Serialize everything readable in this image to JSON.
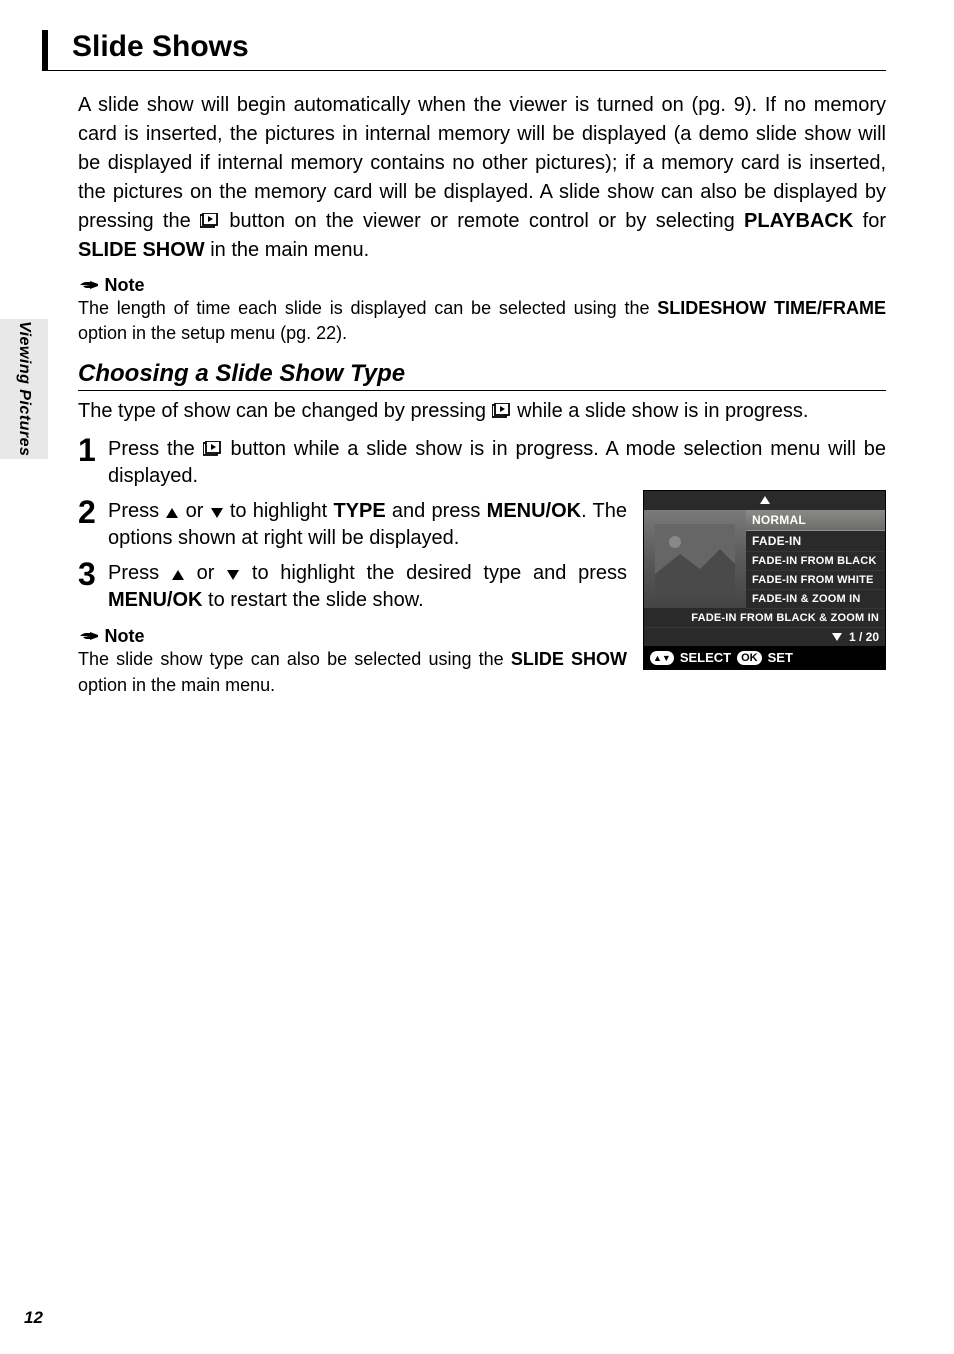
{
  "side_tab": "Viewing Pictures",
  "title": "Slide Shows",
  "intro": {
    "p1a": "A slide show will begin automatically when the viewer is turned on (pg. 9).  If no memory card is inserted, the pictures in internal memory will be displayed (a demo slide show will be displayed if internal memory contains no other pictures); if a memory card is inserted, the pictures on the memory card will be displayed.  A slide show can also be displayed by pressing the ",
    "p1b": " button on the viewer or remote control or by selecting ",
    "p1c": "PLAYBACK",
    "p1d": " for ",
    "p1e": "SLIDE SHOW",
    "p1f": " in the main menu."
  },
  "note1": {
    "label": "Note",
    "t1": "The length of time each slide is displayed can be selected using the ",
    "t2": "SLIDESHOW TIME/FRAME",
    "t3": " option in the setup menu (pg. 22)."
  },
  "sub": {
    "heading": "Choosing a Slide Show Type",
    "intro_a": "The type of show can be changed by pressing ",
    "intro_b": " while a slide show is in progress."
  },
  "steps": {
    "s1": {
      "n": "1",
      "a": "Press the ",
      "b": " button while a slide show is in progress.  A mode selection menu will be displayed."
    },
    "s2": {
      "n": "2",
      "a": "Press ",
      "b": " or ",
      "c": " to highlight ",
      "d": "TYPE",
      "e": " and press ",
      "f": "MENU/OK",
      "g": ".  The options shown at right will be displayed."
    },
    "s3": {
      "n": "3",
      "a": "Press ",
      "b": " or ",
      "c": " to highlight the desired type and press ",
      "d": "MENU/OK",
      "e": " to restart the slide show."
    }
  },
  "note2": {
    "label": "Note",
    "a": "The slide show type can also be selected using the ",
    "b": "SLIDE SHOW",
    "c": " option in the main menu."
  },
  "screen": {
    "items": [
      "NORMAL",
      "FADE-IN",
      "FADE-IN FROM BLACK",
      "FADE-IN FROM WHITE",
      "FADE-IN & ZOOM IN",
      "FADE-IN FROM BLACK & ZOOM IN"
    ],
    "selected_index": 0,
    "counter": "1 / 20",
    "help_select": "SELECT",
    "help_set": "SET",
    "help_ok": "OK"
  },
  "page_number": "12"
}
